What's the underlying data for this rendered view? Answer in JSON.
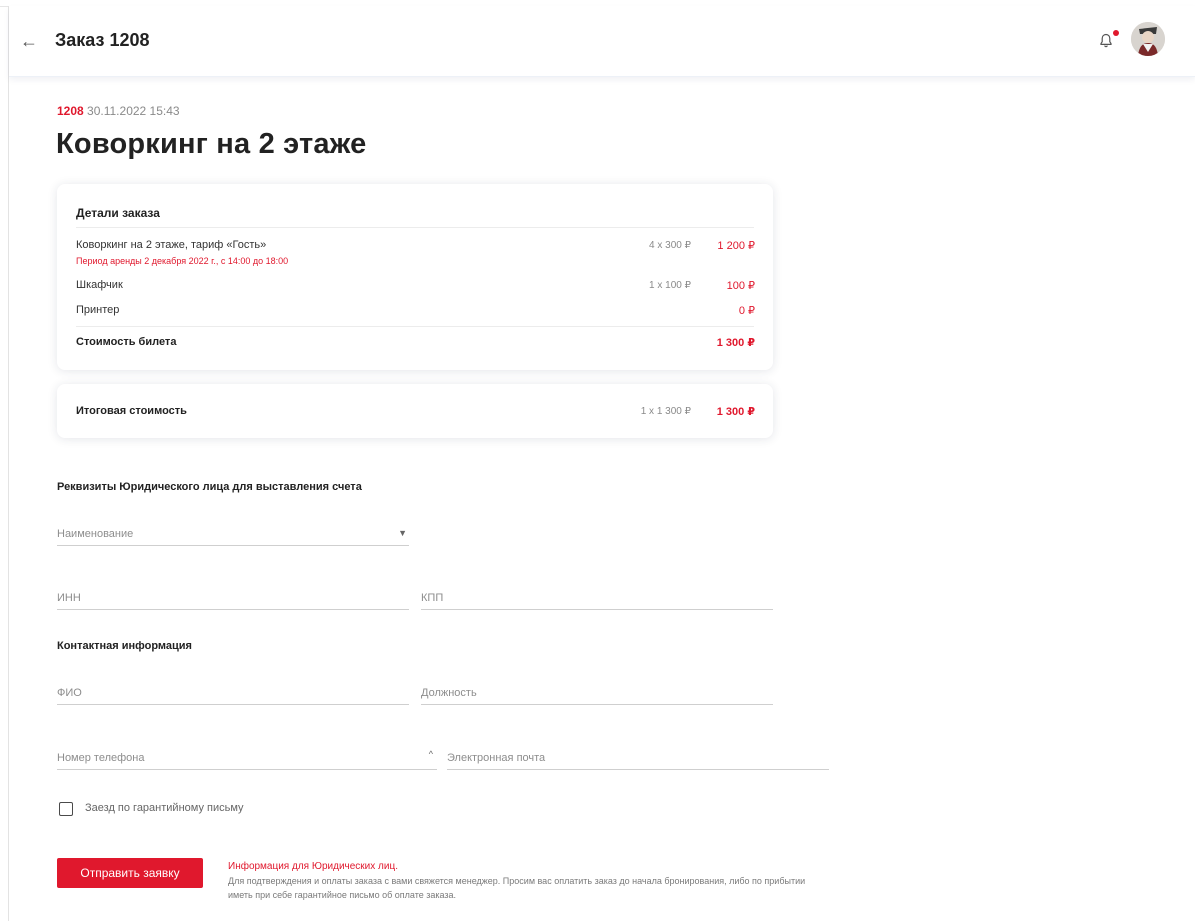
{
  "header": {
    "title": "Заказ 1208",
    "back_icon": "arrow-left-icon",
    "bell_icon": "bell-icon",
    "accent": "#e0182d"
  },
  "order": {
    "number": "1208",
    "datetime": "30.11.2022 15:43",
    "title": "Коворкинг на 2 этаже"
  },
  "details": {
    "title": "Детали заказа",
    "items": [
      {
        "label": "Коворкинг на 2 этаже, тариф «Гость»",
        "sub": "Период аренды 2 декабря 2022 г., с 14:00 до 18:00",
        "qty": "4 x 300 ₽",
        "price": "1 200 ₽"
      },
      {
        "label": "Шкафчик",
        "sub": "",
        "qty": "1 x 100 ₽",
        "price": "100 ₽"
      },
      {
        "label": "Принтер",
        "sub": "",
        "qty": "",
        "price": "0 ₽"
      }
    ],
    "ticket_label": "Стоимость билета",
    "ticket_price": "1 300 ₽"
  },
  "total": {
    "label": "Итоговая стоимость",
    "qty": "1 x 1 300 ₽",
    "price": "1 300 ₽"
  },
  "legal": {
    "title": "Реквизиты Юридического лица для выставления счета",
    "name_placeholder": "Наименование",
    "inn_placeholder": "ИНН",
    "kpp_placeholder": "КПП"
  },
  "contact": {
    "title": "Контактная информация",
    "fio_placeholder": "ФИО",
    "position_placeholder": "Должность",
    "phone_placeholder": "Номер телефона",
    "email_placeholder": "Электронная почта"
  },
  "guarantee": {
    "label": "Заезд по гарантийному письму"
  },
  "submit": {
    "label": "Отправить заявку"
  },
  "info": {
    "title": "Информация для Юридических лиц.",
    "text": "Для подтверждения и оплаты заказа с вами свяжется менеджер. Просим вас оплатить заказ до начала бронирования, либо по прибытии иметь при себе гарантийное письмо об оплате заказа."
  }
}
